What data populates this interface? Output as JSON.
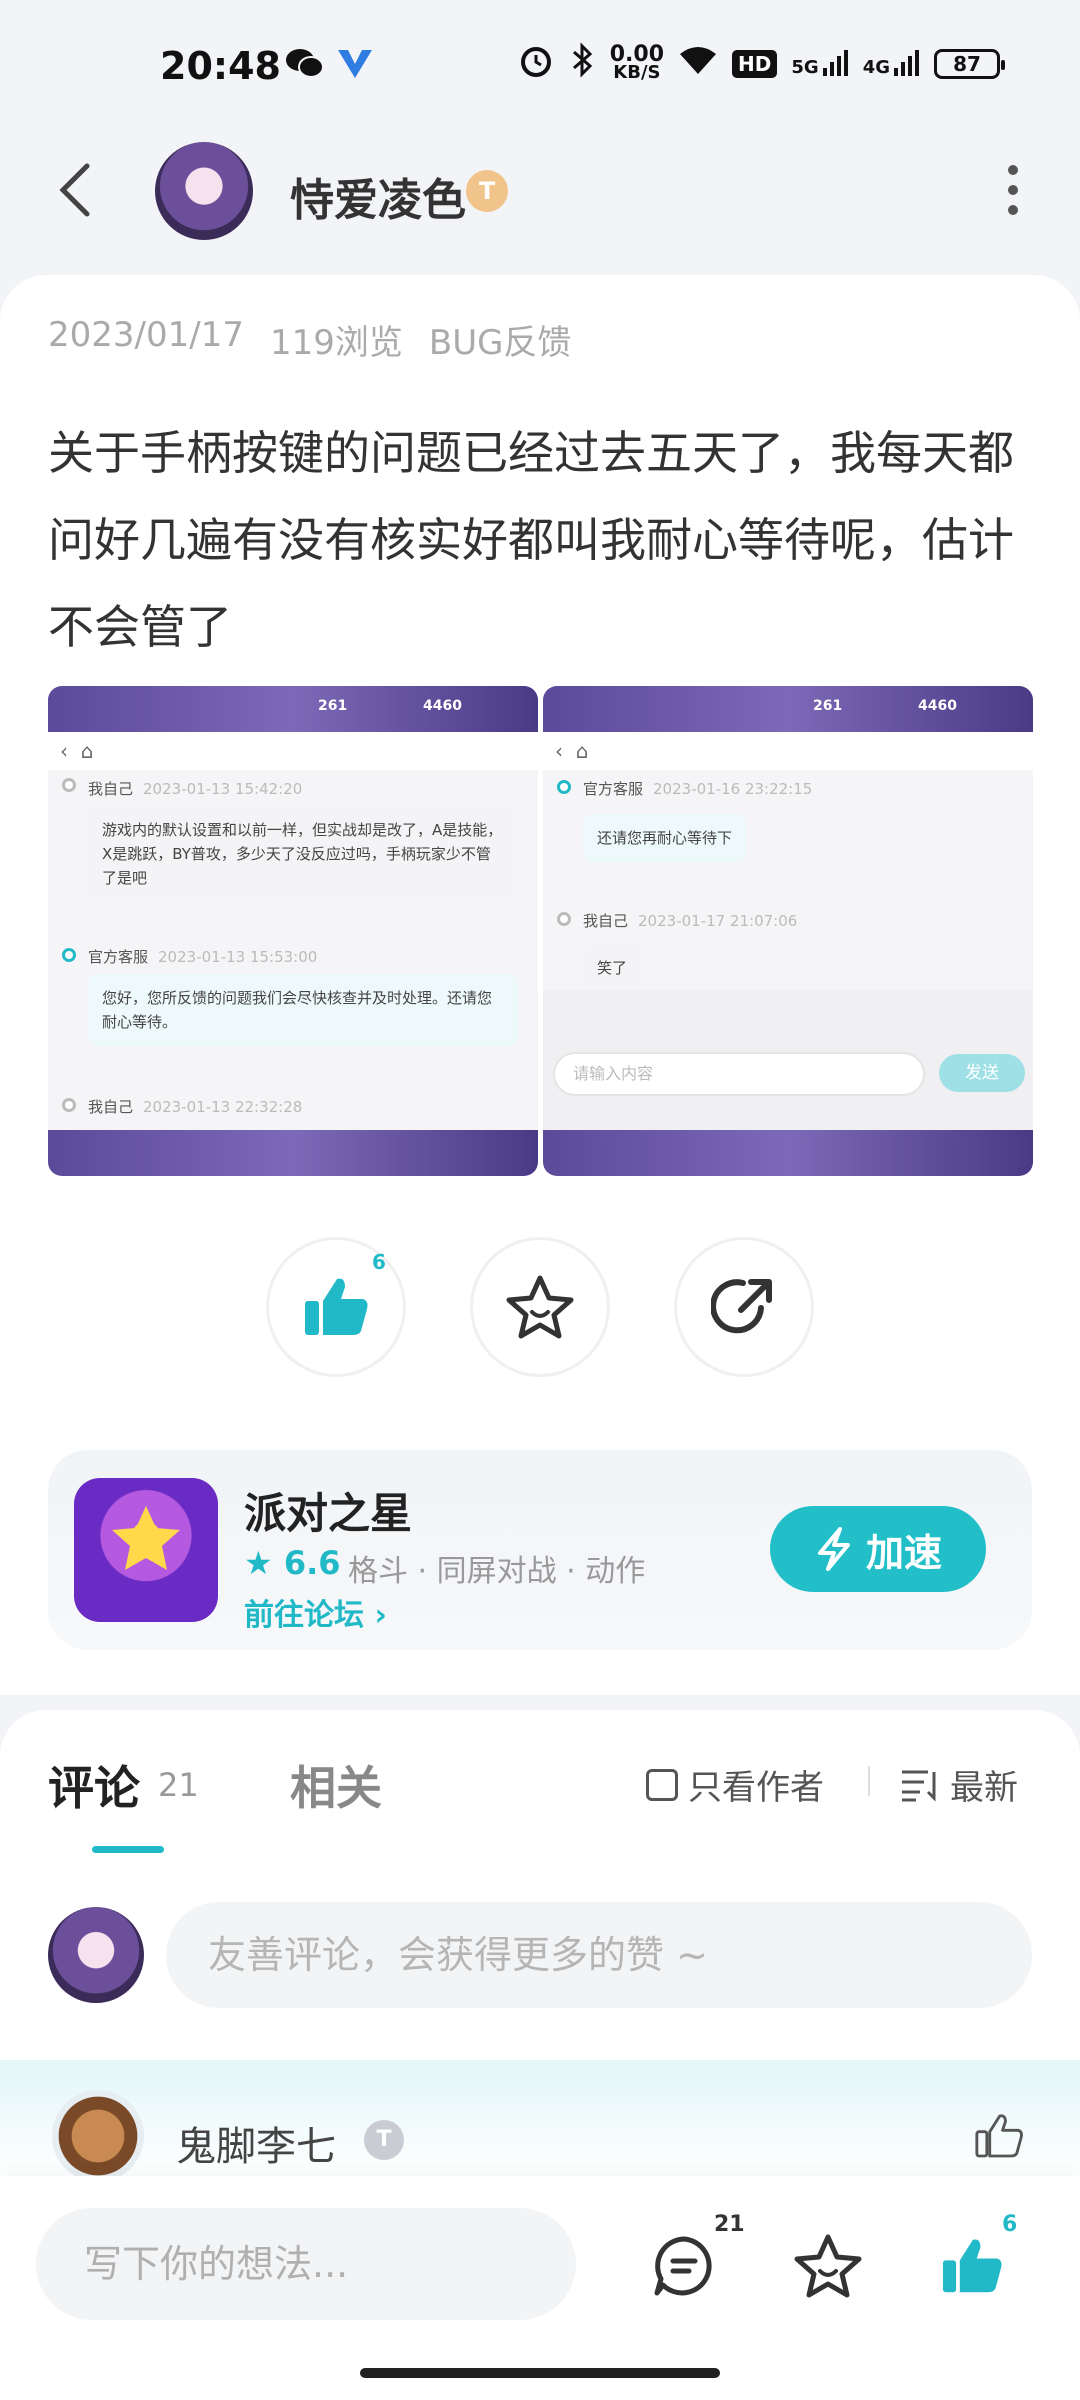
{
  "status_bar": {
    "time": "20:48",
    "net_speed_value": "0.00",
    "net_speed_unit": "KB/S",
    "hd_label": "HD",
    "sig1": "5G",
    "sig2": "4G",
    "battery": "87"
  },
  "header": {
    "author_name": "恃爱凌色",
    "author_level": "T"
  },
  "post": {
    "date": "2023/01/17",
    "views": "119浏览",
    "category": "BUG反馈",
    "content": "关于手柄按键的问题已经过去五天了，我每天都问好几遍有没有核实好都叫我耐心等待呢，估计不会管了"
  },
  "screenshot_left": {
    "stat1": "261",
    "stat2": "4460",
    "m1_head": "我自己",
    "m1_time": "2023-01-13 15:42:20",
    "m1_text": "游戏内的默认设置和以前一样，但实战却是改了，A是技能，X是跳跃，BY普攻，多少天了没反应过吗，手柄玩家少不管了是吧",
    "m2_head": "官方客服",
    "m2_time": "2023-01-13 15:53:00",
    "m2_text": "您好，您所反馈的问题我们会尽快核查并及时处理。还请您耐心等待。",
    "m3_head": "我自己",
    "m3_time": "2023-01-13 22:32:28"
  },
  "screenshot_right": {
    "stat1": "261",
    "stat2": "4460",
    "m1_head": "官方客服",
    "m1_time": "2023-01-16 23:22:15",
    "m1_text": "还请您再耐心等待下",
    "m2_head": "我自己",
    "m2_time": "2023-01-17 21:07:06",
    "m2_text": "笑了",
    "input_placeholder": "请输入内容",
    "send_label": "发送"
  },
  "actions": {
    "like_count": "6"
  },
  "game": {
    "name": "派对之星",
    "rating": "6.6",
    "tags": "格斗 · 同屏对战 · 动作",
    "forum_link": "前往论坛",
    "speed_button": "加速"
  },
  "comments": {
    "tab_comment": "评论",
    "count": "21",
    "tab_related": "相关",
    "only_author": "只看作者",
    "sort": "最新",
    "input_placeholder": "友善评论，会获得更多的赞 ~",
    "first_comment_author": "鬼脚李七",
    "first_comment_level": "T"
  },
  "bottom_bar": {
    "write_placeholder": "写下你的想法...",
    "comment_count": "21",
    "like_count": "6"
  },
  "colors": {
    "accent": "#21b9c7",
    "speed_button": "#22bfc8"
  }
}
